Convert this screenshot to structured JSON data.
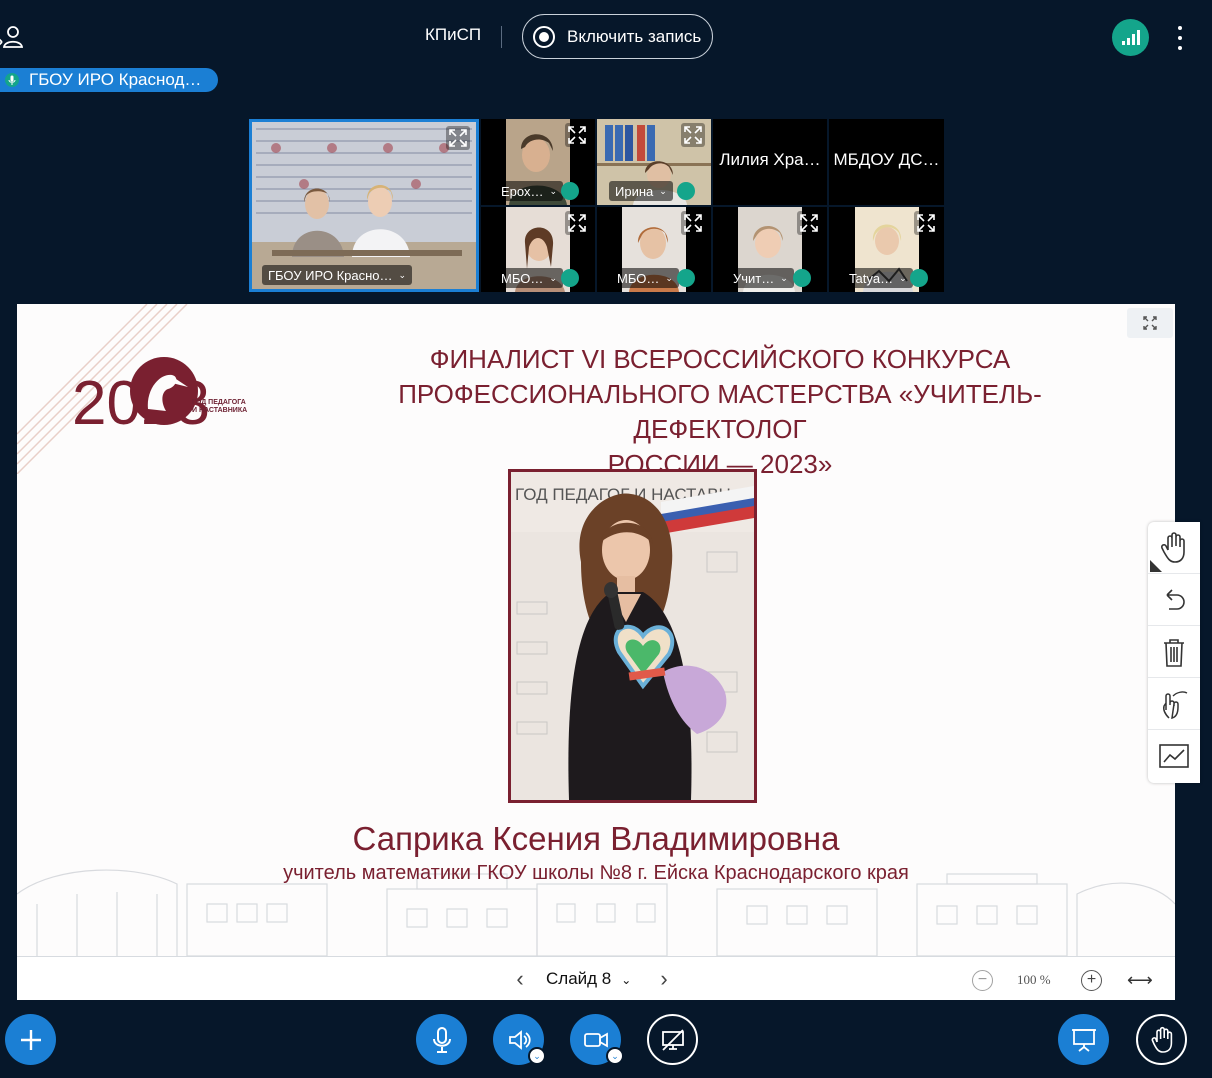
{
  "header": {
    "room_title": "КПиСП",
    "record_label": "Включить запись"
  },
  "talking_indicator": {
    "label": "ГБОУ ИРО Краснод…"
  },
  "participants": [
    {
      "name": "ГБОУ ИРО Красно…",
      "active": true
    },
    {
      "name": "Ерох…"
    },
    {
      "name": "Ирина"
    },
    {
      "name": "Лилия Хра…"
    },
    {
      "name": "МБДОУ ДС…"
    },
    {
      "name": "МБО…"
    },
    {
      "name": "МБО…"
    },
    {
      "name": "Учит…"
    },
    {
      "name": "Tatya…"
    }
  ],
  "slide": {
    "logo_year": "2023",
    "logo_caption": "ГОД ПЕДАГОГА И НАСТАВНИКА",
    "title_lines": [
      "ФИНАЛИСТ VI ВСЕРОССИЙСКОГО КОНКУРСА",
      "ПРОФЕССИОНАЛЬНОГО МАСТЕРСТВА «УЧИТЕЛЬ-ДЕФЕКТОЛОГ",
      "РОССИИ — 2023»"
    ],
    "photo_banner": "ГОД ПЕДАГОГ И НАСТАВН",
    "person_name": "Саприка Ксения Владимировна",
    "person_role": "учитель математики ГКОУ школы №8 г. Ейска Краснодарского края"
  },
  "presentation_nav": {
    "slide_label": "Слайд 8",
    "zoom": "100 %"
  },
  "toolbar_tools": [
    "pan",
    "undo",
    "clear",
    "multi-user",
    "pencil"
  ],
  "colors": {
    "background": "#06172a",
    "accent_blue": "#1b7fd4",
    "accent_green": "#14a58b",
    "slide_text": "#7a2030"
  }
}
